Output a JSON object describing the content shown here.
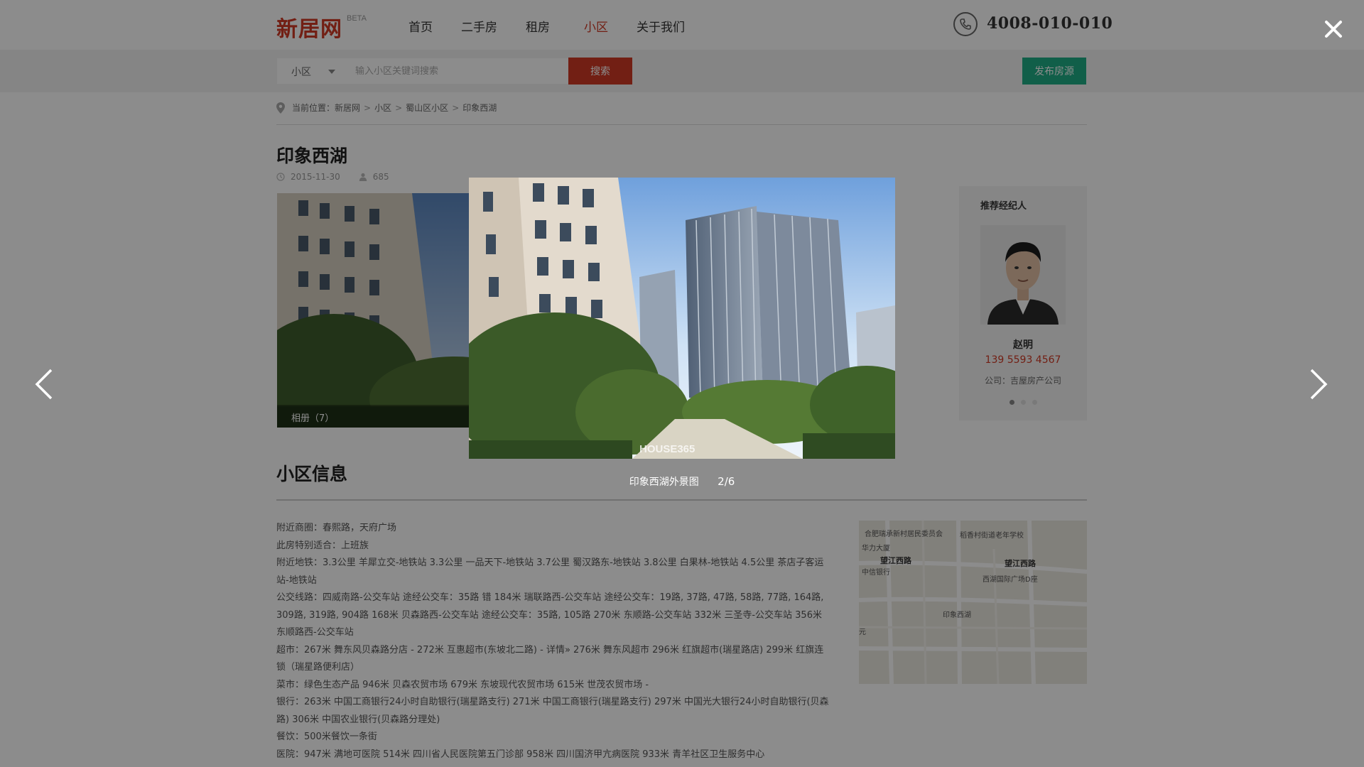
{
  "header": {
    "logo": "新居网",
    "beta": "BETA",
    "nav": [
      "首页",
      "二手房",
      "租房",
      "小区",
      "关于我们"
    ],
    "phone": "4008-010-010"
  },
  "search": {
    "type": "小区",
    "placeholder": "输入小区关键词搜索",
    "button": "搜索",
    "publish": "发布房源"
  },
  "breadcrumb": {
    "prefix": "当前位置：",
    "items": [
      "新居网",
      "小区",
      "蜀山区小区",
      "印象西湖"
    ],
    "sep": ">"
  },
  "page": {
    "title": "印象西湖",
    "date": "2015-11-30",
    "views": "685",
    "album": "相册（7）"
  },
  "agent": {
    "heading": "推荐经纪人",
    "name": "赵明",
    "phone": "139 5593 4567",
    "company": "公司：吉屋房产公司",
    "dots_total": 3,
    "dots_active": 0
  },
  "info": {
    "title": "小区信息",
    "rows": [
      {
        "label": "附近商圈：",
        "text": "春熙路，天府广场"
      },
      {
        "label": "此房特别适合：",
        "text": "上班族"
      },
      {
        "label": "附近地铁：",
        "text": "3.3公里 羊犀立交-地铁站 3.3公里 一品天下-地铁站 3.7公里 蜀汉路东-地铁站 3.8公里 白果林-地铁站 4.5公里 茶店子客运站-地铁站"
      },
      {
        "label": "公交线路：",
        "text": "四威南路-公交车站 途经公交车：35路 错 184米 瑞联路西-公交车站 途经公交车：19路, 37路, 47路, 58路, 77路, 164路, 309路, 319路, 904路 168米 贝森路西-公交车站 途经公交车：35路, 105路 270米 东顺路-公交车站 332米 三圣寺-公交车站 356米 东顺路西-公交车站"
      },
      {
        "label": "超市：",
        "text": "267米 舞东风贝森路分店 - 272米 互惠超市(东坡北二路) - 详情» 276米 舞东风超市 296米 红旗超市(瑞星路店) 299米 红旗连锁（瑞星路便利店）"
      },
      {
        "label": "菜市：",
        "text": "绿色生态产品 946米 贝森农贸市场 679米 东坡现代农贸市场 615米 世茂农贸市场 -"
      },
      {
        "label": "银行：",
        "text": "263米 中国工商银行24小时自助银行(瑞星路支行) 271米 中国工商银行(瑞星路支行) 297米 中国光大银行24小时自助银行(贝森路) 306米 中国农业银行(贝森路分理处)"
      },
      {
        "label": "餐饮：",
        "text": "500米餐饮一条街"
      },
      {
        "label": "医院：",
        "text": "947米 满地可医院 514米 四川省人民医院第五门诊部 958米 四川国济甲亢病医院 933米 青羊社区卫生服务中心"
      }
    ]
  },
  "map": {
    "labels": [
      "合肥瑞承新村居民委员会",
      "稻香村街道老年学校",
      "华力大厦",
      "望江西路",
      "望江西路",
      "中信银行",
      "西湖国际广场D座",
      "印象西湖",
      "元"
    ]
  },
  "lightbox": {
    "caption": "印象西湖外景图",
    "counter": "2/6",
    "watermark": "HOUSE365"
  },
  "colors": {
    "brand_red": "#cf3a25",
    "publish_green": "#1fae86"
  }
}
